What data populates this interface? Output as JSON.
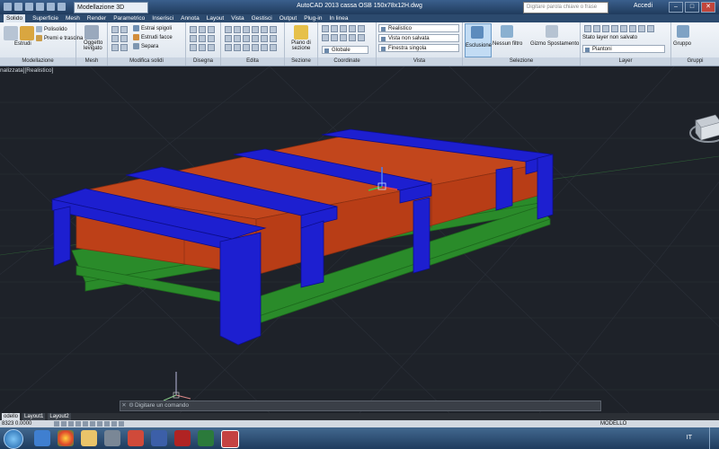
{
  "titlebar": {
    "workspace": "Modellazione 3D",
    "title": "AutoCAD 2013    cassa OSB 150x78x12H.dwg",
    "search_placeholder": "Digitare parola chiave o frase",
    "login": "Accedi",
    "minimize": "–",
    "maximize": "□",
    "close": "✕"
  },
  "tabs": [
    "Solido",
    "Superficie",
    "Mesh",
    "Render",
    "Parametrico",
    "Inserisci",
    "Annota",
    "Layout",
    "Vista",
    "Gestisci",
    "Output",
    "Plug-in",
    "In linea"
  ],
  "ribbon": {
    "panels": {
      "modellazione": "Modellazione",
      "mesh": "Mesh",
      "modifica_solidi": "Modifica solidi",
      "disegna": "Disegna",
      "edita": "Edita",
      "sezione": "Sezione",
      "coordinate": "Coordinate",
      "vista": "Vista",
      "selezione": "Selezione",
      "layer": "Layer",
      "gruppi": "Gruppi"
    },
    "estrudi": "Estrudi",
    "polisolido": "Polisolido",
    "premi_trascina": "Premi e trascina",
    "oggetto_levigato": "Oggetto levigato",
    "estrai_spigoli": "Estrai spigoli",
    "estrudi_facce": "Estrudi facce",
    "separa": "Separa",
    "piano_sezione": "Piano di sezione",
    "globale": "Globale",
    "visual_style": "Realistico",
    "view_name": "Vista non salvata",
    "viewport_config": "Finestra singola",
    "esclusione": "Esclusione",
    "nessun_filtro": "Nessun filtro",
    "gizmo": "Gizmo Spostamento",
    "layer_state": "Stato layer non salvato",
    "layer_current": "Piantoni",
    "gruppo": "Gruppo"
  },
  "viewport": {
    "label": "nalizzata][Realistico]"
  },
  "command": {
    "prompt": "Digitare un comando"
  },
  "layouts": [
    "odello",
    "Layout1",
    "Layout2"
  ],
  "status": {
    "coords": "8323  0.0000",
    "mode": "MODELLO"
  },
  "tray": {
    "lang": "IT"
  },
  "colors": {
    "plank": "#c2461c",
    "stringer": "#1d1fd0",
    "frame": "#2a8b2a",
    "viewport_bg": "#1e2229"
  }
}
